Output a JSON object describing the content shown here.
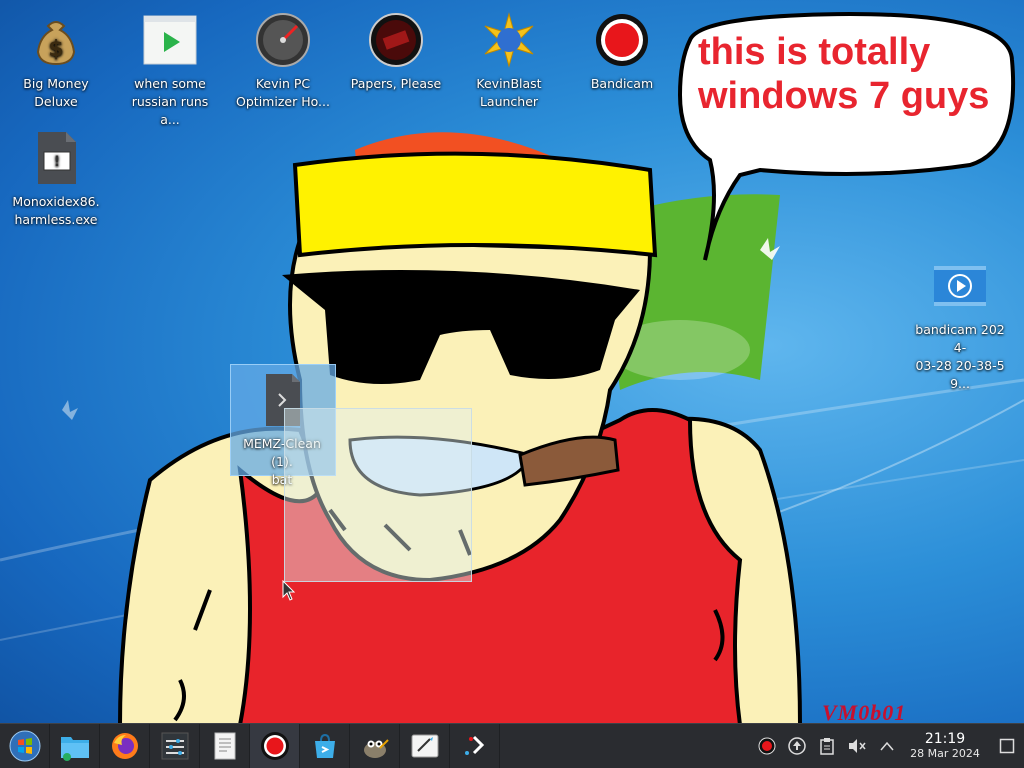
{
  "desktop": {
    "icons": [
      {
        "name": "big-money-deluxe",
        "label": "Big Money\nDeluxe"
      },
      {
        "name": "when-some-russian",
        "label": "when some\nrussian runs a..."
      },
      {
        "name": "kevin-pc-optimizer",
        "label": "Kevin PC\nOptimizer Ho..."
      },
      {
        "name": "papers-please",
        "label": "Papers, Please"
      },
      {
        "name": "kevinblast-launcher",
        "label": "KevinBlast\nLauncher"
      },
      {
        "name": "bandicam",
        "label": "Bandicam"
      },
      {
        "name": "monoxidex86",
        "label": "Monoxidex86.\nharmless.exe"
      },
      {
        "name": "memz-clean",
        "label": "MEMZ-Clean(1).\nbat"
      },
      {
        "name": "bandicam-video",
        "label": "bandicam 2024-\n03-28 20-38-59..."
      }
    ]
  },
  "wallpaper": {
    "speech_bubble": "this is totally windows 7 guys",
    "signature": "VM0b01"
  },
  "taskbar": {
    "apps": [
      {
        "name": "start-menu",
        "icon": "windows-orb-icon"
      },
      {
        "name": "file-manager",
        "icon": "folder-icon"
      },
      {
        "name": "firefox",
        "icon": "firefox-icon"
      },
      {
        "name": "system-settings",
        "icon": "settings-sliders-icon"
      },
      {
        "name": "text-editor",
        "icon": "document-icon"
      },
      {
        "name": "bandicam",
        "icon": "record-icon"
      },
      {
        "name": "discover-store",
        "icon": "store-bag-icon"
      },
      {
        "name": "gimp",
        "icon": "gimp-icon"
      },
      {
        "name": "drawing-app",
        "icon": "pen-tablet-icon"
      },
      {
        "name": "kdeconnect",
        "icon": "share-icon"
      }
    ],
    "tray": {
      "icons": [
        "record-icon",
        "update-icon",
        "clipboard-icon",
        "volume-muted-icon",
        "chevron-up-icon"
      ],
      "time": "21:19",
      "date": "28 Mar 2024"
    }
  },
  "colors": {
    "accent": "#1a7fd6",
    "bubble_text": "#e8252f",
    "taskbar": "#2a2c30"
  }
}
